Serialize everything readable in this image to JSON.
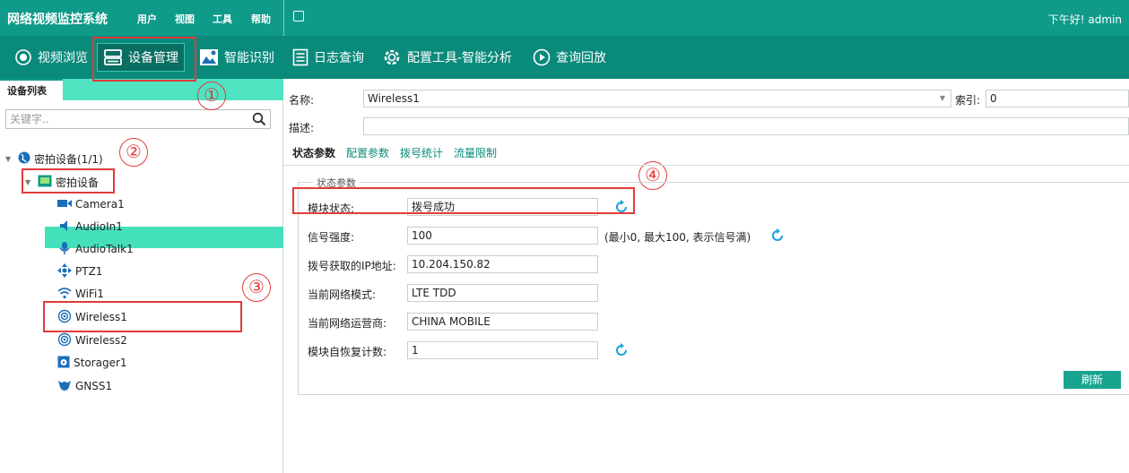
{
  "title_bar": {
    "app_title": "网络视频监控系统",
    "menus": [
      "用户",
      "视图",
      "工具",
      "帮助"
    ],
    "greeting": "下午好! admin"
  },
  "toolbar": {
    "items": [
      {
        "label": "视频浏览",
        "icon": "camera-icon"
      },
      {
        "label": "设备管理",
        "icon": "device-management-icon",
        "active": true
      },
      {
        "label": "智能识别",
        "icon": "smart-recognition-icon"
      },
      {
        "label": "日志查询",
        "icon": "log-icon"
      },
      {
        "label": "配置工具-智能分析",
        "icon": "gear-icon"
      },
      {
        "label": "查询回放",
        "icon": "play-circle-icon"
      }
    ]
  },
  "sidebar": {
    "tab_label": "设备列表",
    "search_placeholder": "关键字..",
    "tree": {
      "root_label": "密拍设备(1/1)",
      "device_label": "密拍设备",
      "children": [
        "Camera1",
        "AudioIn1",
        "AudioTalk1",
        "PTZ1",
        "WiFi1",
        "Wireless1",
        "Wireless2",
        "Storager1",
        "GNSS1"
      ],
      "selected": "Wireless1"
    }
  },
  "annotations": [
    "①",
    "②",
    "③",
    "④"
  ],
  "detail": {
    "name_label": "名称:",
    "name_value": "Wireless1",
    "index_label": "索引:",
    "index_value": "0",
    "desc_label": "描述:",
    "desc_value": "",
    "tabs": [
      "状态参数",
      "配置参数",
      "拨号统计",
      "流量限制"
    ],
    "active_tab": "状态参数",
    "group_title": "状态参数",
    "rows": [
      {
        "label": "模块状态:",
        "value": "拨号成功",
        "note": ""
      },
      {
        "label": "信号强度:",
        "value": "100",
        "note": "(最小0, 最大100, 表示信号满)"
      },
      {
        "label": "拨号获取的IP地址:",
        "value": "10.204.150.82",
        "note": ""
      },
      {
        "label": "当前网络模式:",
        "value": "LTE TDD",
        "note": ""
      },
      {
        "label": "当前网络运营商:",
        "value": "CHINA MOBILE",
        "note": ""
      },
      {
        "label": "模块自恢复计数:",
        "value": "1",
        "note": ""
      }
    ],
    "refresh_button": "刷新"
  },
  "colors": {
    "title_bar": "#0f9a8a",
    "toolbar": "#0a8a7b",
    "selection": "#44e0bb",
    "annotation_red": "#e23b3b"
  }
}
